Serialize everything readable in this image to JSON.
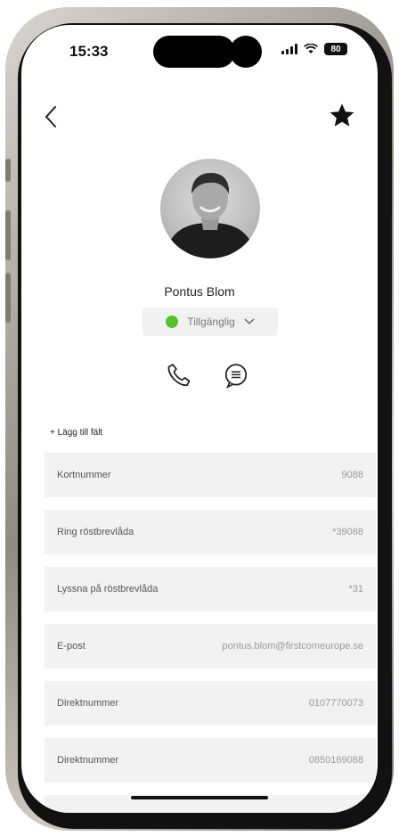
{
  "status_bar": {
    "time": "15:33",
    "battery": "80"
  },
  "contact": {
    "name": "Pontus Blom",
    "presence": {
      "label": "Tillgänglig",
      "color": "#57c12b"
    }
  },
  "actions": {
    "call_icon": "phone-icon",
    "chat_icon": "chat-bubble-icon"
  },
  "add_field_label": "+ Lägg till fält",
  "fields": [
    {
      "label": "Kortnummer",
      "value": "9088"
    },
    {
      "label": "Ring röstbrevlåda",
      "value": "*39088"
    },
    {
      "label": "Lyssna på röstbrevlåda",
      "value": "*31"
    },
    {
      "label": "E-post",
      "value": "pontus.blom@firstcomeurope.se"
    },
    {
      "label": "Direktnummer",
      "value": "0107770073"
    },
    {
      "label": "Direktnummer",
      "value": "0850169088"
    }
  ]
}
